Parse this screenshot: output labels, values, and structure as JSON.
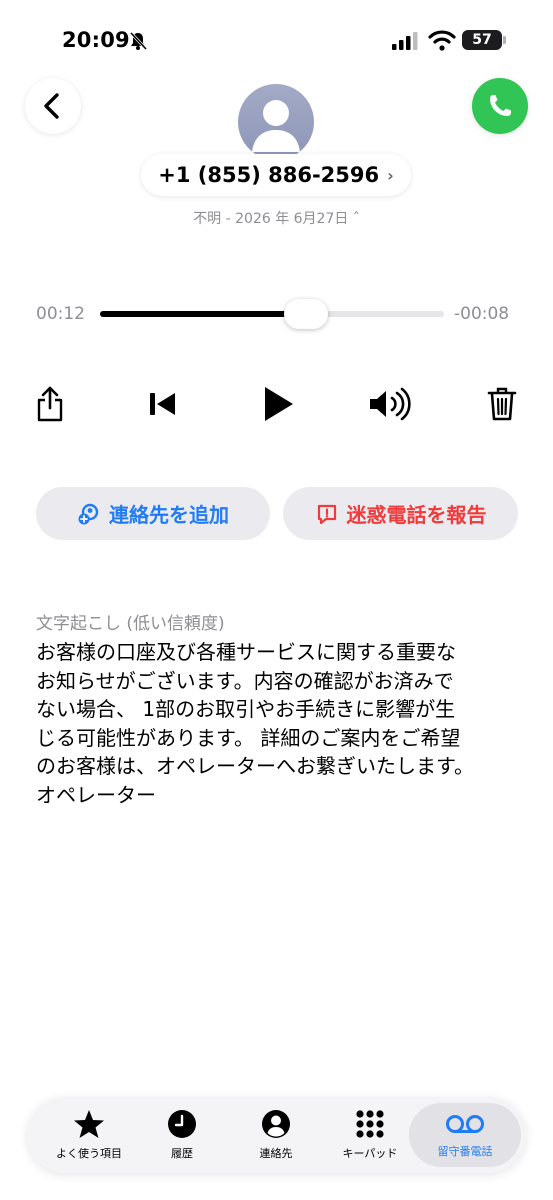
{
  "status_bar": {
    "time": "20:09",
    "battery": "57"
  },
  "header": {
    "phone_number": "+1 (855) 886-2596",
    "chevron": "›",
    "subtitle": "不明 - 2026 年 6月27日 ˆ"
  },
  "player": {
    "elapsed": "00:12",
    "remaining": "-00:08",
    "progress": 0.6
  },
  "actions": {
    "add_contact": "連絡先を追加",
    "report_spam": "迷惑電話を報告"
  },
  "transcript": {
    "title": "文字起こし (低い信頼度)",
    "body": "お客様の口座及び各種サービスに関する重要な\nお知らせがございます。内容の確認がお済みで\nない場合、 1部のお取引やお手続きに影響が生\nじる可能性があります。 詳細のご案内をご希望\nのお客様は、オペレーターへお繋ぎいたします。\nオペレーター"
  },
  "tabs": [
    {
      "label": "よく使う項目",
      "icon": "star-icon"
    },
    {
      "label": "履歴",
      "icon": "clock-icon"
    },
    {
      "label": "連絡先",
      "icon": "person-circle-icon"
    },
    {
      "label": "キーパッド",
      "icon": "keypad-icon"
    },
    {
      "label": "留守番電話",
      "icon": "voicemail-icon",
      "active": true
    }
  ],
  "colors": {
    "accent": "#1f7cf5",
    "danger": "#ef3b3b",
    "call_green": "#30c554"
  }
}
